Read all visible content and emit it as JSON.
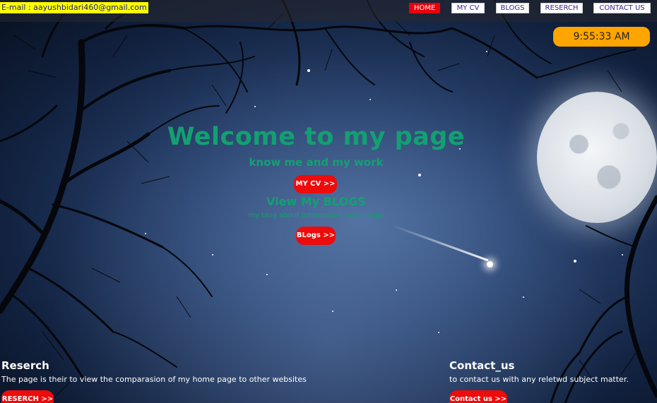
{
  "header": {
    "email": "E-mail : aayushbidari460@gmail.com",
    "nav": [
      {
        "label": "HOME",
        "active": true
      },
      {
        "label": "MY CV",
        "active": false
      },
      {
        "label": "BLOGS",
        "active": false
      },
      {
        "label": "RESERCH",
        "active": false
      },
      {
        "label": "CONTACT US",
        "active": false
      }
    ],
    "clock": "9:55:33 AM"
  },
  "hero": {
    "title": "Welcome to my page",
    "subtitle": "know me and my work",
    "cv_button": "MY CV >>",
    "blogs_title": "View My BLOGS",
    "blogs_description": "my blog about information technology",
    "blogs_button": "BLogs >>"
  },
  "research": {
    "title": "Reserch",
    "text": "The page is their to view the comparasion of my home page to other websites",
    "button": "RESERCH >>"
  },
  "contact": {
    "title": "Contact_us",
    "text": "to contact us with any reletwd subject matter.",
    "button": "Contact us >>"
  },
  "colors": {
    "accent_green": "#13a071",
    "button_red": "#ee0b0b",
    "clock_orange": "#ffa500",
    "email_highlight": "#ffff00"
  }
}
